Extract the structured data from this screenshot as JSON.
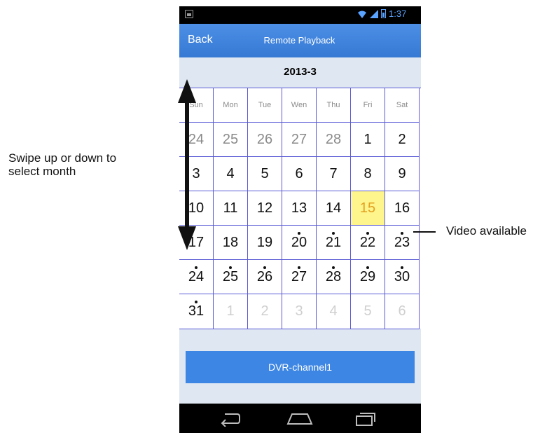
{
  "status_bar": {
    "time": "1:37"
  },
  "header": {
    "back_label": "Back",
    "title": "Remote Playback"
  },
  "calendar": {
    "month": "2013-3",
    "weekdays": [
      "Sun",
      "Mon",
      "Tue",
      "Wen",
      "Thu",
      "Fri",
      "Sat"
    ],
    "weeks": [
      [
        "24",
        "25",
        "26",
        "27",
        "28",
        "1",
        "2"
      ],
      [
        "3",
        "4",
        "5",
        "6",
        "7",
        "8",
        "9"
      ],
      [
        "10",
        "11",
        "12",
        "13",
        "14",
        "15",
        "16"
      ],
      [
        "17",
        "18",
        "19",
        "20",
        "21",
        "22",
        "23"
      ],
      [
        "24",
        "25",
        "26",
        "27",
        "28",
        "29",
        "30"
      ],
      [
        "31",
        "1",
        "2",
        "3",
        "4",
        "5",
        "6"
      ]
    ],
    "selected_day": "15",
    "selected_color": "#fef58c",
    "video_available_days": [
      "20",
      "21",
      "22",
      "23",
      "24",
      "25",
      "26",
      "27",
      "28",
      "29",
      "30",
      "31"
    ]
  },
  "channel_button": {
    "label": "DVR-channel1"
  },
  "nav_bar": {
    "icons": [
      "back-icon",
      "home-icon",
      "recent-apps-icon"
    ]
  },
  "annotations": {
    "swipe": [
      "Swipe up or down to",
      "select month"
    ],
    "video": "Video available"
  },
  "colors": {
    "accent": "#3e86e3",
    "grid_line": "#5b5bd6",
    "page_bg": "#dfe7f2"
  }
}
